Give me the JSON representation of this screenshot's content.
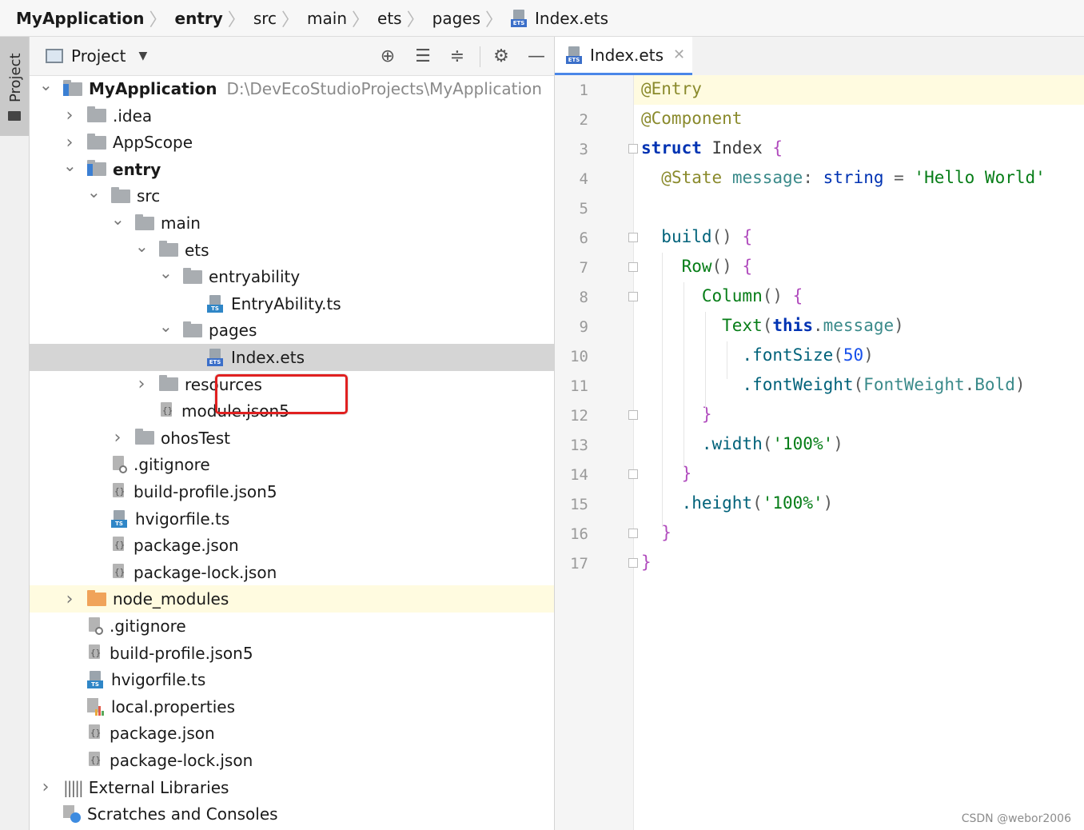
{
  "breadcrumb": [
    {
      "label": "MyApplication",
      "bold": true
    },
    {
      "label": "entry",
      "bold": true
    },
    {
      "label": "src"
    },
    {
      "label": "main"
    },
    {
      "label": "ets"
    },
    {
      "label": "pages"
    },
    {
      "label": "Index.ets",
      "icon": "ets-file-icon"
    }
  ],
  "side_panel": {
    "tab_label": "Project"
  },
  "project_panel": {
    "title": "Project",
    "tools": [
      "locate-icon",
      "expand-all-icon",
      "collapse-all-icon",
      "gear-icon",
      "minimize-icon"
    ],
    "tree": [
      {
        "label": "MyApplication",
        "path": "D:\\DevEcoStudioProjects\\MyApplication",
        "icon": "module-folder-icon",
        "expanded": true,
        "bold": true,
        "depth": 0
      },
      {
        "label": ".idea",
        "icon": "folder-icon",
        "expanded": false,
        "depth": 1
      },
      {
        "label": "AppScope",
        "icon": "folder-icon",
        "expanded": false,
        "depth": 1
      },
      {
        "label": "entry",
        "icon": "module-folder-icon",
        "expanded": true,
        "bold": true,
        "depth": 1
      },
      {
        "label": "src",
        "icon": "folder-icon",
        "expanded": true,
        "depth": 2
      },
      {
        "label": "main",
        "icon": "folder-icon",
        "expanded": true,
        "depth": 3
      },
      {
        "label": "ets",
        "icon": "folder-icon",
        "expanded": true,
        "depth": 4
      },
      {
        "label": "entryability",
        "icon": "folder-icon",
        "expanded": true,
        "depth": 5
      },
      {
        "label": "EntryAbility.ts",
        "icon": "ts-file-icon",
        "depth": 6
      },
      {
        "label": "pages",
        "icon": "folder-icon",
        "expanded": true,
        "depth": 5
      },
      {
        "label": "Index.ets",
        "icon": "ets-file-icon",
        "depth": 6,
        "selected": true
      },
      {
        "label": "resources",
        "icon": "folder-icon",
        "expanded": false,
        "depth": 4
      },
      {
        "label": "module.json5",
        "icon": "json-file-icon",
        "depth": 4
      },
      {
        "label": "ohosTest",
        "icon": "folder-icon",
        "expanded": false,
        "depth": 3
      },
      {
        "label": ".gitignore",
        "icon": "gitignore-file-icon",
        "depth": 2
      },
      {
        "label": "build-profile.json5",
        "icon": "json-file-icon",
        "depth": 2
      },
      {
        "label": "hvigorfile.ts",
        "icon": "ts-file-icon",
        "depth": 2
      },
      {
        "label": "package.json",
        "icon": "json-file-icon",
        "depth": 2
      },
      {
        "label": "package-lock.json",
        "icon": "json-file-icon",
        "depth": 2
      },
      {
        "label": "node_modules",
        "icon": "orange-folder-icon",
        "expanded": false,
        "depth": 1,
        "highlighted": true
      },
      {
        "label": ".gitignore",
        "icon": "gitignore-file-icon",
        "depth": 1
      },
      {
        "label": "build-profile.json5",
        "icon": "json-file-icon",
        "depth": 1
      },
      {
        "label": "hvigorfile.ts",
        "icon": "ts-file-icon",
        "depth": 1
      },
      {
        "label": "local.properties",
        "icon": "properties-file-icon",
        "depth": 1
      },
      {
        "label": "package.json",
        "icon": "json-file-icon",
        "depth": 1
      },
      {
        "label": "package-lock.json",
        "icon": "json-file-icon",
        "depth": 1
      },
      {
        "label": "External Libraries",
        "icon": "library-icon",
        "expanded": false,
        "depth": 0
      },
      {
        "label": "Scratches and Consoles",
        "icon": "scratches-icon",
        "depth": 0
      }
    ]
  },
  "editor": {
    "tab": {
      "label": "Index.ets",
      "icon": "ets-file-icon",
      "close_icon": "close-icon"
    },
    "current_line": 1,
    "lines": [
      [
        {
          "t": "@Entry",
          "c": "ann"
        }
      ],
      [
        {
          "t": "@Component",
          "c": "ann"
        }
      ],
      [
        {
          "t": "struct",
          "c": "kw"
        },
        {
          "t": " ",
          "c": "pun"
        },
        {
          "t": "Index",
          "c": "id"
        },
        {
          "t": " ",
          "c": "pun"
        },
        {
          "t": "{",
          "c": "brc"
        }
      ],
      [
        {
          "t": "  ",
          "c": "pun"
        },
        {
          "t": "@State",
          "c": "ann"
        },
        {
          "t": " ",
          "c": "pun"
        },
        {
          "t": "message",
          "c": "cp"
        },
        {
          "t": ": ",
          "c": "pun"
        },
        {
          "t": "string",
          "c": "kw2"
        },
        {
          "t": " = ",
          "c": "pun"
        },
        {
          "t": "'Hello World'",
          "c": "str"
        }
      ],
      [],
      [
        {
          "t": "  ",
          "c": "pun"
        },
        {
          "t": "build",
          "c": "fn"
        },
        {
          "t": "() ",
          "c": "pun"
        },
        {
          "t": "{",
          "c": "brc"
        }
      ],
      [
        {
          "t": "    ",
          "c": "pun"
        },
        {
          "t": "Row",
          "c": "str"
        },
        {
          "t": "() ",
          "c": "pun"
        },
        {
          "t": "{",
          "c": "brc"
        }
      ],
      [
        {
          "t": "      ",
          "c": "pun"
        },
        {
          "t": "Column",
          "c": "str"
        },
        {
          "t": "() ",
          "c": "pun"
        },
        {
          "t": "{",
          "c": "brc"
        }
      ],
      [
        {
          "t": "        ",
          "c": "pun"
        },
        {
          "t": "Text",
          "c": "str"
        },
        {
          "t": "(",
          "c": "pun"
        },
        {
          "t": "this",
          "c": "kw"
        },
        {
          "t": ".",
          "c": "pun"
        },
        {
          "t": "message",
          "c": "cp"
        },
        {
          "t": ")",
          "c": "pun"
        }
      ],
      [
        {
          "t": "          ",
          "c": "pun"
        },
        {
          "t": ".fontSize",
          "c": "fn"
        },
        {
          "t": "(",
          "c": "pun"
        },
        {
          "t": "50",
          "c": "num"
        },
        {
          "t": ")",
          "c": "pun"
        }
      ],
      [
        {
          "t": "          ",
          "c": "pun"
        },
        {
          "t": ".fontWeight",
          "c": "fn"
        },
        {
          "t": "(",
          "c": "pun"
        },
        {
          "t": "FontWeight",
          "c": "cp"
        },
        {
          "t": ".",
          "c": "pun"
        },
        {
          "t": "Bold",
          "c": "cp"
        },
        {
          "t": ")",
          "c": "pun"
        }
      ],
      [
        {
          "t": "      ",
          "c": "pun"
        },
        {
          "t": "}",
          "c": "brc"
        }
      ],
      [
        {
          "t": "      ",
          "c": "pun"
        },
        {
          "t": ".width",
          "c": "fn"
        },
        {
          "t": "(",
          "c": "pun"
        },
        {
          "t": "'100%'",
          "c": "str"
        },
        {
          "t": ")",
          "c": "pun"
        }
      ],
      [
        {
          "t": "    ",
          "c": "pun"
        },
        {
          "t": "}",
          "c": "brc"
        }
      ],
      [
        {
          "t": "    ",
          "c": "pun"
        },
        {
          "t": ".height",
          "c": "fn"
        },
        {
          "t": "(",
          "c": "pun"
        },
        {
          "t": "'100%'",
          "c": "str"
        },
        {
          "t": ")",
          "c": "pun"
        }
      ],
      [
        {
          "t": "  ",
          "c": "pun"
        },
        {
          "t": "}",
          "c": "brc"
        }
      ],
      [
        {
          "t": "}",
          "c": "brc"
        }
      ]
    ],
    "fold_lines": [
      3,
      6,
      7,
      8,
      12,
      14,
      16,
      17
    ]
  },
  "watermark": "CSDN @webor2006",
  "colors": {
    "accent": "#4a86e8",
    "selection": "#d5d5d5",
    "current_line": "#fffbe0",
    "callout": "#e02020"
  }
}
